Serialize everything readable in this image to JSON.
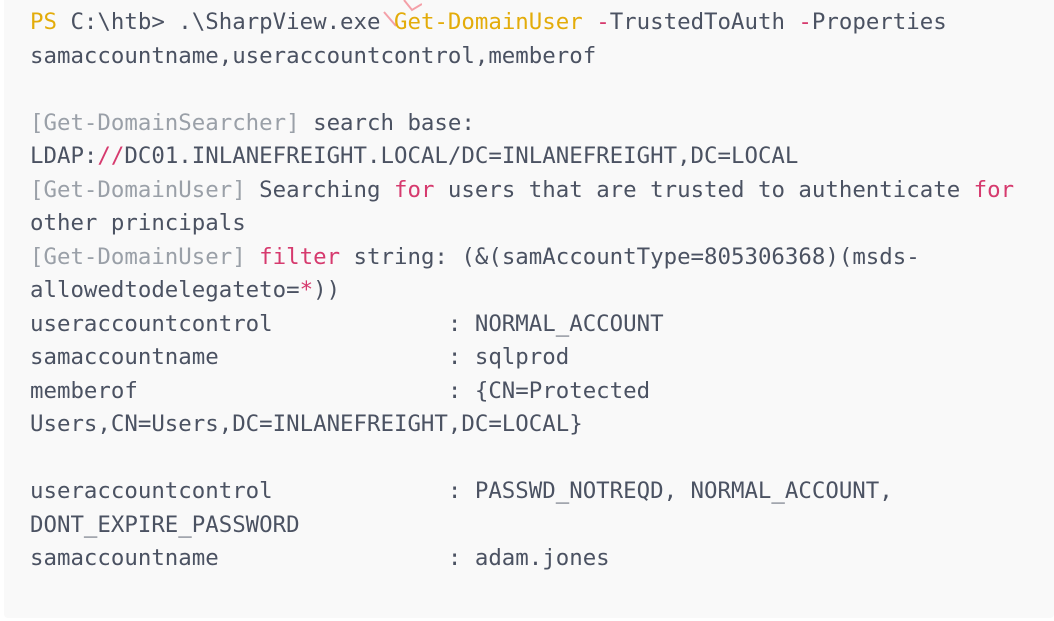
{
  "terminal": {
    "lines": [
      [
        [
          "kw",
          "PS"
        ],
        [
          "t",
          " C:\\htb> .\\SharpView.exe "
        ],
        [
          "kw",
          "Get-DomainUser"
        ],
        [
          "t",
          " "
        ],
        [
          "pink",
          "-"
        ],
        [
          "t",
          "TrustedToAuth "
        ],
        [
          "pink",
          "-"
        ],
        [
          "t",
          "Properties"
        ]
      ],
      [
        [
          "t",
          "samaccountname,useraccountcontrol,memberof"
        ]
      ],
      [
        [
          "t",
          ""
        ]
      ],
      [
        [
          "cm",
          "[Get-DomainSearcher]"
        ],
        [
          "t",
          " search base:"
        ]
      ],
      [
        [
          "t",
          "LDAP:"
        ],
        [
          "pink",
          "//"
        ],
        [
          "t",
          "DC01.INLANEFREIGHT.LOCAL/DC=INLANEFREIGHT,DC=LOCAL"
        ]
      ],
      [
        [
          "cm",
          "[Get-DomainUser]"
        ],
        [
          "t",
          " Searching "
        ],
        [
          "pink",
          "for"
        ],
        [
          "t",
          " users that are trusted to authenticate "
        ],
        [
          "pink",
          "for"
        ]
      ],
      [
        [
          "t",
          "other principals"
        ]
      ],
      [
        [
          "cm",
          "[Get-DomainUser]"
        ],
        [
          "t",
          " "
        ],
        [
          "pink",
          "filter"
        ],
        [
          "t",
          " string: (&(samAccountType=805306368)(msds-"
        ]
      ],
      [
        [
          "t",
          "allowedtodelegateto="
        ],
        [
          "pink",
          "*"
        ],
        [
          "t",
          "))"
        ]
      ],
      [
        [
          "t",
          "useraccountcontrol             : NORMAL_ACCOUNT"
        ]
      ],
      [
        [
          "t",
          "samaccountname                 : sqlprod"
        ]
      ],
      [
        [
          "t",
          "memberof                       : {CN=Protected"
        ]
      ],
      [
        [
          "t",
          "Users,CN=Users,DC=INLANEFREIGHT,DC=LOCAL}"
        ]
      ],
      [
        [
          "t",
          ""
        ]
      ],
      [
        [
          "t",
          "useraccountcontrol             : PASSWD_NOTREQD, NORMAL_ACCOUNT,"
        ]
      ],
      [
        [
          "t",
          "DONT_EXPIRE_PASSWORD"
        ]
      ],
      [
        [
          "t",
          "samaccountname                 : adam.jones"
        ]
      ]
    ]
  }
}
